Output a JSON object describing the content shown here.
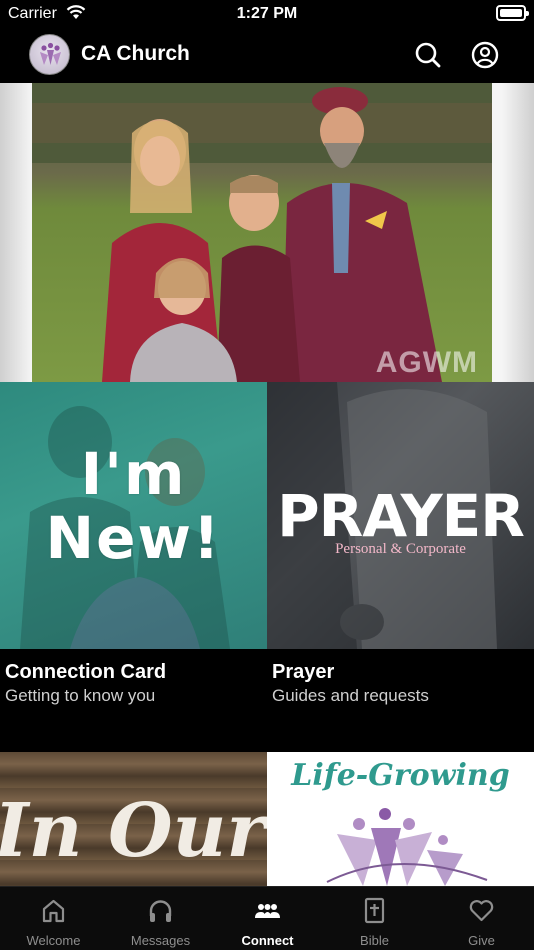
{
  "status_bar": {
    "carrier": "Carrier",
    "time": "1:27 PM"
  },
  "header": {
    "title": "CA Church"
  },
  "hero": {
    "watermark": "AGWM",
    "slides": 4,
    "active_slide": 1
  },
  "tiles": [
    {
      "title": "Connection Card",
      "subtitle": "Getting to know you",
      "image_text": "I'm New!"
    },
    {
      "title": "Prayer",
      "subtitle": "Guides and requests",
      "image_text": "PRAYER",
      "image_subtext": "Personal & Corporate"
    },
    {
      "image_text": "In Our"
    },
    {
      "image_text": "Life-Growing"
    }
  ],
  "tab_bar": {
    "items": [
      {
        "label": "Welcome",
        "icon": "home-icon"
      },
      {
        "label": "Messages",
        "icon": "headphones-icon"
      },
      {
        "label": "Connect",
        "icon": "people-icon"
      },
      {
        "label": "Bible",
        "icon": "bible-icon"
      },
      {
        "label": "Give",
        "icon": "heart-icon"
      }
    ],
    "active": "Connect"
  },
  "colors": {
    "background": "#000000",
    "accent_teal": "#2f9a8e",
    "tab_inactive": "#8e8e8e"
  }
}
